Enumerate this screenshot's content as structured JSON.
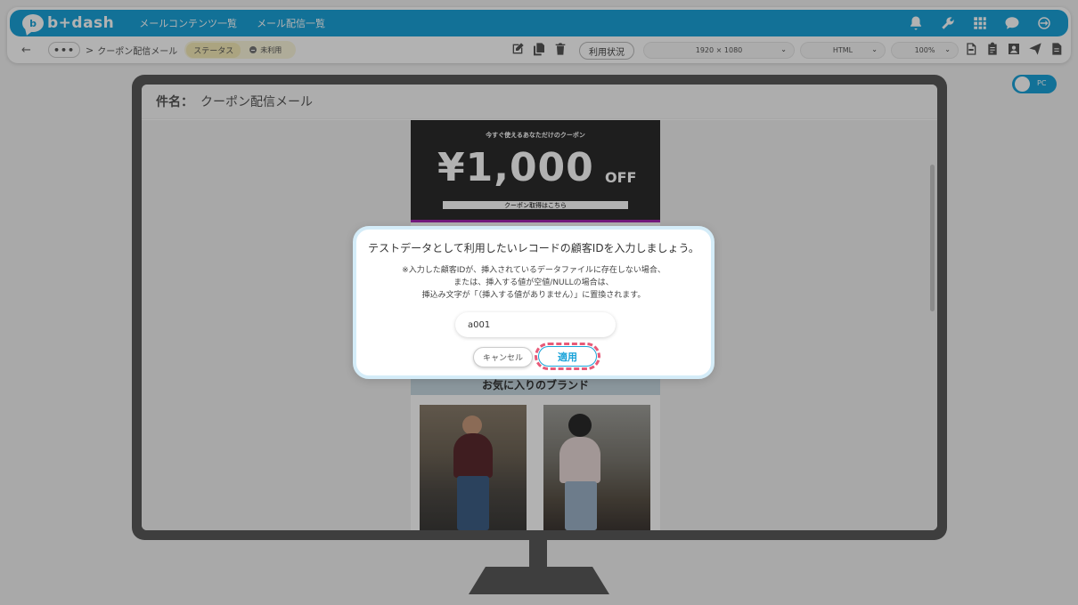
{
  "header": {
    "logo_mark": "b",
    "logo_text": "b+dash",
    "nav": [
      "メールコンテンツ一覧",
      "メール配信一覧"
    ],
    "icons": [
      "bell-icon",
      "wrench-icon",
      "grid-icon",
      "chat-icon",
      "logout-icon"
    ]
  },
  "toolbar": {
    "back": "←",
    "more": "•••",
    "breadcrumb_sep": ">",
    "breadcrumb": "クーポン配信メール",
    "status_label": "ステータス",
    "status_value": "未利用",
    "usage_button": "利用状況",
    "resolution": "1920 × 1080",
    "format": "HTML",
    "zoom": "100%",
    "chev": "⌄"
  },
  "pc_toggle": "PC",
  "preview": {
    "subject_label": "件名：",
    "subject": "クーポン配信メール",
    "hero_sub": "今すぐ使えるあなただけのクーポン",
    "hero_price": "¥1,000",
    "hero_off": "OFF",
    "hero_button": "クーポン取得はこちら",
    "brand_band": "お気に入りのブランド"
  },
  "dialog": {
    "title": "テストデータとして利用したいレコードの顧客IDを入力しましょう。",
    "note_1": "※入力した顧客IDが、挿入されているデータファイルに存在しない場合、",
    "note_2": "または、挿入する値が空値/NULLの場合は、",
    "note_3": "挿込み文字が「（挿入する値がありません）」に置換されます。",
    "input_value": "a001",
    "cancel": "キャンセル",
    "apply": "適用"
  },
  "colors": {
    "brand": "#1aa3d9",
    "hero_bg": "#2b2b2b",
    "hero_bar": "#a526b3",
    "highlight_ring": "#e85a78"
  }
}
